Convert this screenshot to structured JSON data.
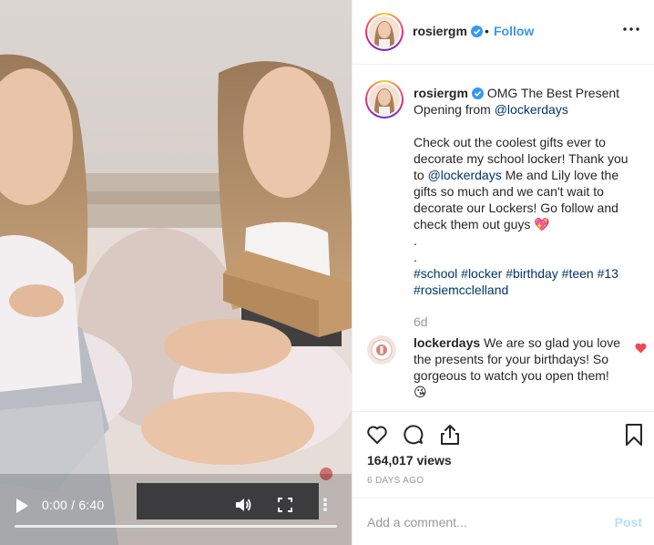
{
  "video": {
    "time": "0:00 / 6:40",
    "progress": 0
  },
  "header": {
    "username": "rosiergm",
    "separator": "•",
    "follow_label": "Follow"
  },
  "caption": {
    "username": "rosiergm",
    "title_part1": "OMG The Best Present Opening from ",
    "mention_title": "@lockerdays",
    "line_a": "Check out the coolest gifts ever to decorate my school locker! Thank you to ",
    "mention_body": "@lockerdays",
    "line_b": " Me and Lily love the gifts so much and we can't wait to decorate our Lockers! Go follow and check them out guys ",
    "emoji_heart": "💖",
    "dot1": ".",
    "dot2": ".",
    "hashtags": [
      "#school",
      "#locker",
      "#birthday",
      "#teen",
      "#13",
      "#rosiemcclelland"
    ],
    "time_ago": "6d"
  },
  "comment": {
    "username": "lockerdays",
    "text": "We are so glad you love the presents for your birthdays! So gorgeous to watch you open them! ",
    "emoji": "😘"
  },
  "stats": {
    "views": "164,017 views",
    "date": "6 DAYS AGO"
  },
  "add_comment": {
    "placeholder": "Add a comment...",
    "post_label": "Post"
  },
  "colors": {
    "accent": "#3897f0",
    "link": "#003569",
    "muted": "#999999",
    "like_red": "#ed4956",
    "post_disabled": "#b2dffc"
  }
}
